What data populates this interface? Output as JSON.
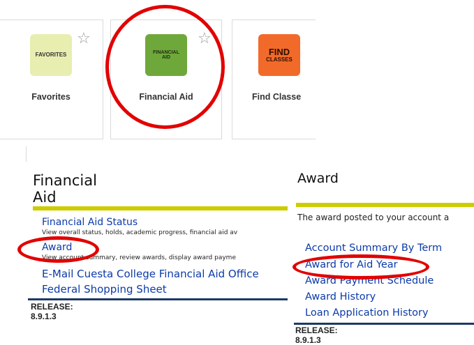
{
  "tiles": [
    {
      "label": "Favorites",
      "icon_text": "FAVORITES",
      "icon_color": "#e8eeb0",
      "icon_text_color": "#333333"
    },
    {
      "label": "Financial Aid",
      "icon_text_1": "FINANCIAL",
      "icon_text_2": "AID",
      "icon_color": "#6fa83a",
      "icon_text_color": "#1f2d12"
    },
    {
      "label": "Find Classe",
      "icon_text_1": "FIND",
      "icon_text_2": "CLASSES",
      "icon_color": "#f26a2a",
      "icon_text_color": "#2a0f00"
    }
  ],
  "star_glyph": "☆",
  "financial_aid_panel": {
    "title": "Financial Aid",
    "links": [
      {
        "label": "Financial Aid Status",
        "desc": "View overall status, holds, academic progress, financial aid av"
      },
      {
        "label": "Award",
        "desc": "View account summary, review awards, display award payme"
      },
      {
        "label": "E-Mail Cuesta College Financial Aid Office"
      },
      {
        "label": "Federal Shopping Sheet"
      }
    ],
    "release": "RELEASE: 8.9.1.3"
  },
  "award_panel": {
    "title": "Award",
    "intro": "The award posted to your account a",
    "links": [
      {
        "label": "Account Summary By Term"
      },
      {
        "label": "Award for Aid Year"
      },
      {
        "label": "Award Payment Schedule"
      },
      {
        "label": "Award History"
      },
      {
        "label": "Loan Application History"
      }
    ],
    "release": "RELEASE: 8.9.1.3"
  },
  "colors": {
    "highlight": "#e20000",
    "link": "#0b3aa8",
    "rule_yellow": "#cccc00",
    "rule_navy": "#1d3a66"
  }
}
